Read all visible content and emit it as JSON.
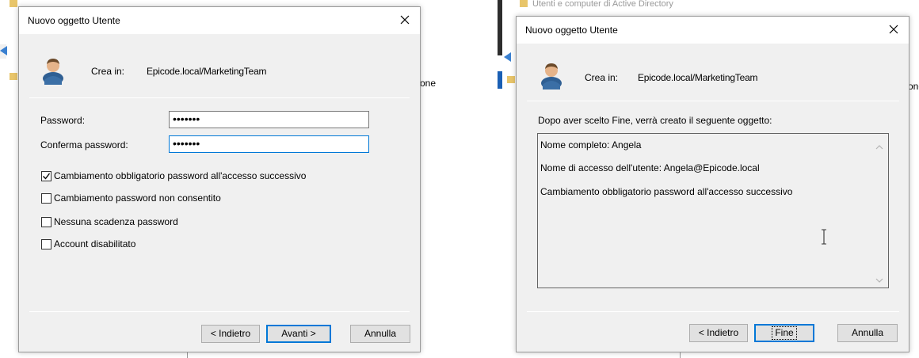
{
  "left_dialog": {
    "title": "Nuovo oggetto Utente",
    "crea_in_label": "Crea in:",
    "crea_in_path": "Epicode.local/MarketingTeam",
    "password_label": "Password:",
    "password_value": "•••••••",
    "confirm_label": "Conferma password:",
    "confirm_value": "•••••••",
    "checkboxes": [
      {
        "label": "Cambiamento obbligatorio password all'accesso successivo",
        "checked": true
      },
      {
        "label": "Cambiamento password non consentito",
        "checked": false
      },
      {
        "label": "Nessuna scadenza password",
        "checked": false
      },
      {
        "label": "Account disabilitato",
        "checked": false
      }
    ],
    "buttons": {
      "back": "< Indietro",
      "next": "Avanti >",
      "cancel": "Annulla"
    }
  },
  "right_dialog": {
    "title": "Nuovo oggetto Utente",
    "crea_in_label": "Crea in:",
    "crea_in_path": "Epicode.local/MarketingTeam",
    "info": "Dopo aver scelto Fine, verrà creato il seguente oggetto:",
    "summary_lines": [
      "Nome completo: Angela",
      "Nome di accesso dell'utente: Angela@Epicode.local",
      "Cambiamento obbligatorio password all'accesso successivo"
    ],
    "buttons": {
      "back": "< Indietro",
      "finish": "Fine",
      "cancel": "Annulla"
    }
  },
  "background": {
    "window_title": "Utenti e computer di Active Directory",
    "left_partial": "one",
    "right_partial": "one"
  },
  "colors": {
    "dialog_bg": "#f0f0f0",
    "focus_border": "#0078d7",
    "button_bg": "#e1e1e1"
  },
  "icons": [
    "user-icon",
    "close-icon",
    "checkmark-icon",
    "back-arrow-icon",
    "folder-icon",
    "i-beam-cursor-icon"
  ]
}
